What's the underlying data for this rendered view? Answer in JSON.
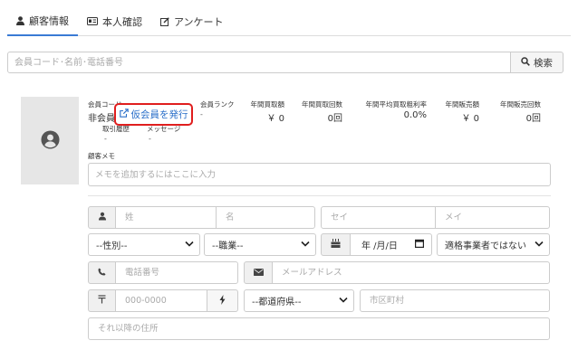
{
  "tabs": [
    {
      "label": "顧客情報",
      "icon": "user-icon",
      "active": true
    },
    {
      "label": "本人確認",
      "icon": "id-card-icon",
      "active": false
    },
    {
      "label": "アンケート",
      "icon": "edit-icon",
      "active": false
    }
  ],
  "search": {
    "placeholder": "会員コード･名前･電話番号",
    "button_label": "検索"
  },
  "member": {
    "code_label": "会員コード",
    "code_value": "非会員",
    "issue_button_label": "仮会員を発行",
    "rank_label": "会員ランク",
    "rank_value": "-",
    "stats": [
      {
        "label": "年間買取額",
        "value": "￥ 0"
      },
      {
        "label": "年間買取回数",
        "value": "0回"
      },
      {
        "label": "年間平均買取粗利率",
        "value": "0.0%"
      },
      {
        "label": "年間販売額",
        "value": "￥ 0"
      },
      {
        "label": "年間販売回数",
        "value": "0回"
      }
    ],
    "history_label": "取引履歴",
    "history_value": "-",
    "message_label": "メッセージ",
    "message_value": "-"
  },
  "memo": {
    "label": "顧客メモ",
    "placeholder": "メモを追加するにはここに入力"
  },
  "form": {
    "last_name_placeholder": "姓",
    "first_name_placeholder": "名",
    "last_kana_placeholder": "セイ",
    "first_kana_placeholder": "メイ",
    "gender_value": "--性別--",
    "occupation_value": "--職業--",
    "birthdate_value": "年 /月/日",
    "qualified_value": "適格事業者ではない",
    "phone_placeholder": "電話番号",
    "email_placeholder": "メールアドレス",
    "zip_placeholder": "000-0000",
    "prefecture_value": "--都道府県--",
    "city_placeholder": "市区町村",
    "address_placeholder": "それ以降の住所"
  },
  "colors": {
    "accent": "#3a7bd5",
    "highlight_border": "#e01e1e",
    "link": "#2a6fc9"
  }
}
